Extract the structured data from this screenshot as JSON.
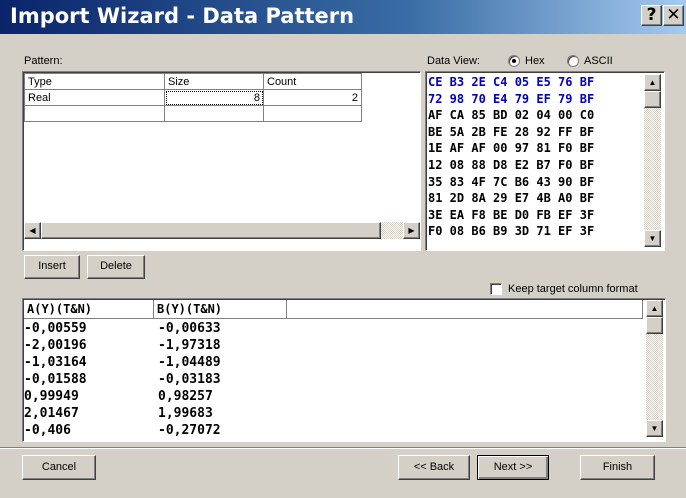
{
  "window": {
    "title": "Import Wizard - Data Pattern",
    "help_glyph": "?",
    "close_glyph": "✕"
  },
  "pattern": {
    "label": "Pattern:",
    "columns": [
      "Type",
      "Size",
      "Count"
    ],
    "rows": [
      {
        "type": "Real",
        "size": "8",
        "count": "2"
      }
    ]
  },
  "buttons": {
    "insert": "Insert",
    "delete": "Delete",
    "cancel": "Cancel",
    "back": "<< Back",
    "next": "Next >>",
    "finish": "Finish"
  },
  "data_view": {
    "label": "Data View:",
    "mode_hex": "Hex",
    "mode_ascii": "ASCII",
    "selected_mode": "Hex",
    "hex_rows": [
      {
        "text": "CE B3 2E C4 05 E5 76 BF",
        "highlight": true
      },
      {
        "text": "72 98 70 E4 79 EF 79 BF",
        "highlight": true
      },
      {
        "text": "AF CA 85 BD 02 04 00 C0",
        "highlight": false
      },
      {
        "text": "BE 5A 2B FE 28 92 FF BF",
        "highlight": false
      },
      {
        "text": "1E AF AF 00 97 81 F0 BF",
        "highlight": false
      },
      {
        "text": "12 08 88 D8 E2 B7 F0 BF",
        "highlight": false
      },
      {
        "text": "35 83 4F 7C B6 43 90 BF",
        "highlight": false
      },
      {
        "text": "81 2D 8A 29 E7 4B A0 BF",
        "highlight": false
      },
      {
        "text": "3E EA F8 BE D0 FB EF 3F",
        "highlight": false
      },
      {
        "text": "F0 08 B6 B9 3D 71 EF 3F",
        "highlight": false
      }
    ]
  },
  "keep_format": {
    "label": "Keep target column format",
    "checked": false
  },
  "preview": {
    "columns": [
      "A(Y)(T&N)",
      "B(Y)(T&N)"
    ],
    "rows": [
      [
        "-0,00559",
        "-0,00633"
      ],
      [
        "-2,00196",
        "-1,97318"
      ],
      [
        "-1,03164",
        "-1,04489"
      ],
      [
        "-0,01588",
        "-0,03183"
      ],
      [
        "0,99949",
        "0,98257"
      ],
      [
        "2,01467",
        "1,99683"
      ],
      [
        "-0,406",
        "-0,27072"
      ]
    ]
  },
  "icons": {
    "scroll_up": "▲",
    "scroll_down": "▼",
    "scroll_left": "◀",
    "scroll_right": "▶"
  },
  "colors": {
    "title_gradient_start": "#0a246a",
    "title_gradient_end": "#a6caf0",
    "hex_highlight": "#0000c0",
    "face": "#d4d0c8"
  }
}
